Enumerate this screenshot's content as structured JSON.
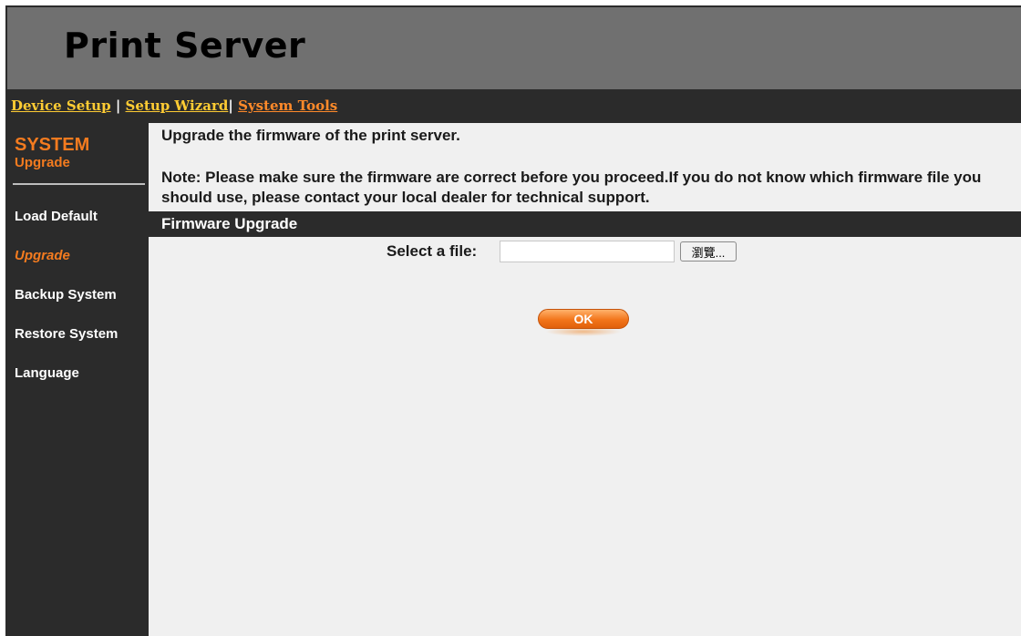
{
  "header": {
    "title": "Print Server"
  },
  "topnav": {
    "device_setup": "Device Setup",
    "setup_wizard": "Setup Wizard",
    "system_tools": "System Tools",
    "separator1": "|",
    "separator2": "|"
  },
  "sidebar": {
    "section_title": "SYSTEM",
    "section_subtitle": "Upgrade",
    "items": [
      {
        "label": "Load Default",
        "active": false
      },
      {
        "label": "Upgrade",
        "active": true
      },
      {
        "label": "Backup System",
        "active": false
      },
      {
        "label": "Restore System",
        "active": false
      },
      {
        "label": "Language",
        "active": false
      }
    ]
  },
  "main": {
    "intro": "Upgrade the firmware of the print server.",
    "note": "Note: Please make sure the firmware are correct before you proceed.If you do not know which firmware file you should use, please contact your local dealer for technical support.",
    "section_title": "Firmware Upgrade",
    "file_label": "Select a file:",
    "file_value": "",
    "browse_label": "瀏覽...",
    "ok_label": "OK"
  },
  "colors": {
    "accent_orange": "#f47b1f",
    "link_yellow": "#ffcc33",
    "dark": "#2b2b2b",
    "header_gray": "#707070",
    "content_bg": "#f0f0f0"
  }
}
